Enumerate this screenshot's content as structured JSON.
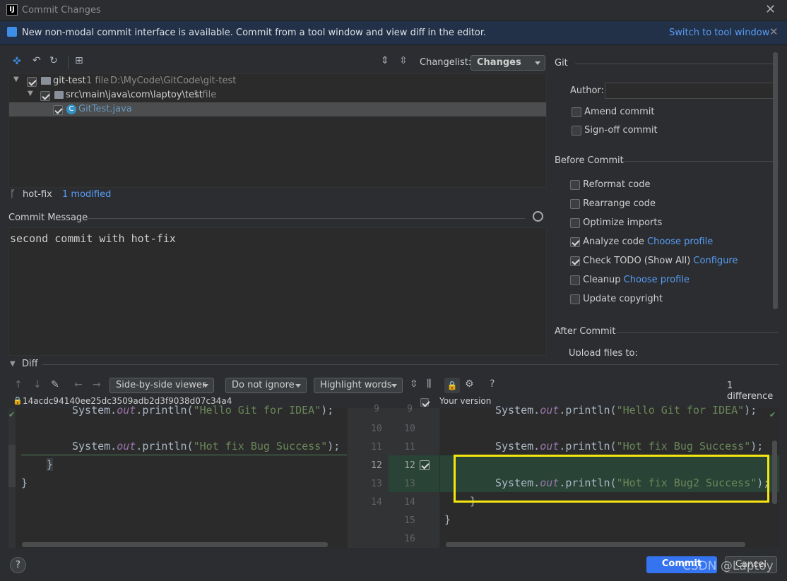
{
  "window": {
    "title": "Commit Changes"
  },
  "banner": {
    "text": "New non-modal commit interface is available. Commit from a tool window and view diff in the editor.",
    "link": "Switch to tool window"
  },
  "toolbar": {
    "changelist_label": "Changelist:",
    "changelist_value": "Changes"
  },
  "tree": {
    "root": {
      "name": "git-test",
      "count": "1 file",
      "path": "D:\\MyCode\\GitCode\\git-test"
    },
    "folder": {
      "name": "src\\main\\java\\com\\laptoy\\test",
      "count": "1 file"
    },
    "file": {
      "name": "GitTest.java"
    }
  },
  "branch": {
    "name": "hot-fix",
    "status": "1 modified"
  },
  "commit_message": {
    "label": "Commit Message",
    "value": "second commit with hot-fix"
  },
  "git": {
    "section": "Git",
    "author_label": "Author:",
    "amend": "Amend commit",
    "signoff": "Sign-off commit"
  },
  "before_commit": {
    "section": "Before Commit",
    "reformat": "Reformat code",
    "rearrange": "Rearrange code",
    "optimize": "Optimize imports",
    "analyze": "Analyze code",
    "analyze_link": "Choose profile",
    "todo": "Check TODO (Show All)",
    "todo_link": "Configure",
    "cleanup": "Cleanup",
    "cleanup_link": "Choose profile",
    "copyright": "Update copyright"
  },
  "after_commit": {
    "section": "After Commit",
    "upload": "Upload files to:"
  },
  "diff": {
    "section": "Diff",
    "viewer": "Side-by-side viewer",
    "ignore": "Do not ignore",
    "highlight": "Highlight words",
    "help": "?",
    "difference_count": "1 difference",
    "hash": "14acdc94140ee25dc3509adb2d3f9038d07c34a4",
    "your_version": "Your version",
    "left_lines": {
      "l1a": "System.",
      "l1b": "out",
      "l1c": ".println(",
      "l1d": "\"Hello Git for IDEA\"",
      "l1e": ");",
      "l2a": "System.",
      "l2b": "out",
      "l2c": ".println(",
      "l2d": "\"Hot fix Bug Success\"",
      "l2e": ");",
      "l3": "}",
      "l4": "}"
    },
    "right_lines": {
      "r1a": "System.",
      "r1b": "out",
      "r1c": ".println(",
      "r1d": "\"Hello Git for IDEA\"",
      "r1e": ");",
      "r2a": "System.",
      "r2b": "out",
      "r2c": ".println(",
      "r2d": "\"Hot fix Bug Success\"",
      "r2e": ");",
      "r3a": "System.",
      "r3b": "out",
      "r3c": ".println(",
      "r3d": "\"Hot fix Bug2 Success\"",
      "r3e": ");",
      "r4": "}",
      "r5": "}"
    },
    "gutter_left": [
      "9",
      "10",
      "11",
      "12",
      "13",
      "14"
    ],
    "gutter_right": [
      "9",
      "10",
      "11",
      "12",
      "13",
      "14",
      "15",
      "16"
    ]
  },
  "footer": {
    "help": "?",
    "commit": "Commit",
    "cancel": "Cancel",
    "watermark": "CSDN @Laptoy"
  },
  "colors": {
    "accent": "#3574f0",
    "highlight_box": "#f5e60f",
    "inserted": "#294436"
  }
}
